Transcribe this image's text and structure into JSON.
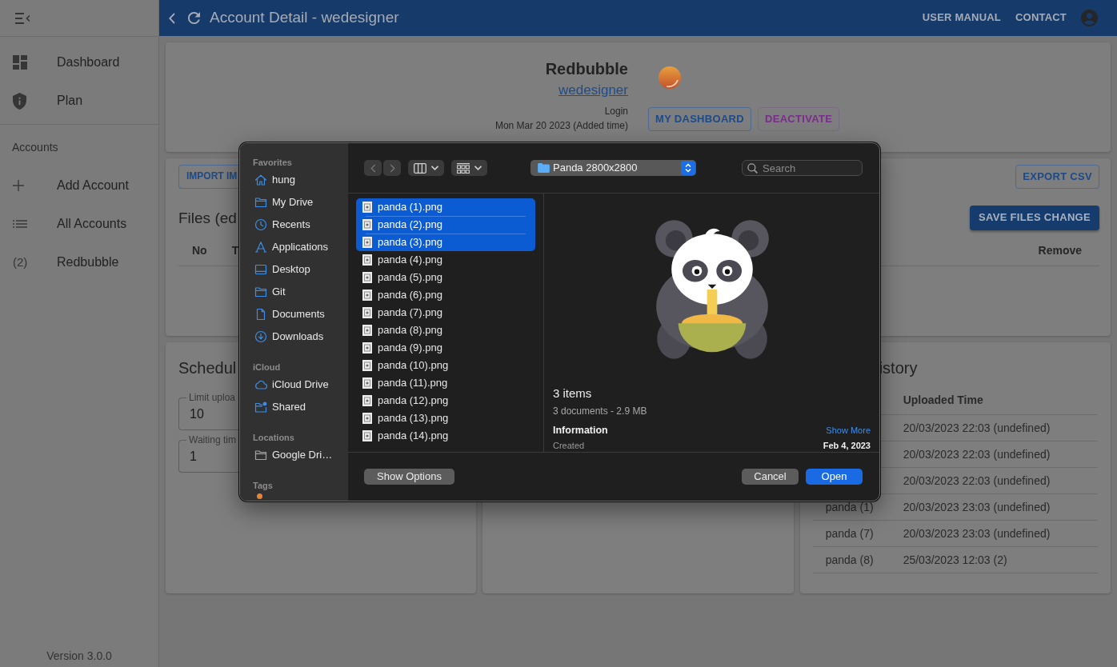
{
  "sidebar": {
    "nav": [
      {
        "label": "Dashboard"
      },
      {
        "label": "Plan"
      }
    ],
    "section_title": "Accounts",
    "accounts": [
      {
        "label": "Add Account"
      },
      {
        "label": "All Accounts"
      },
      {
        "label": "Redbubble",
        "count": "(2)"
      }
    ],
    "version": "Version 3.0.0"
  },
  "header": {
    "title": "Account Detail - wedesigner",
    "links": [
      "USER MANUAL",
      "CONTACT"
    ]
  },
  "account": {
    "platform": "Redbubble",
    "username": "wedesigner",
    "status": "Login",
    "added": "Mon Mar 20 2023 (Added time)",
    "buttons": [
      {
        "label": "MY DASHBOARD",
        "kind": "primary"
      },
      {
        "label": "DEACTIVATE",
        "kind": "secondary"
      }
    ]
  },
  "files": {
    "import_button": "IMPORT IM",
    "export_button": "EXPORT CSV",
    "title": "Files (ed",
    "save_button": "SAVE FILES CHANGE",
    "columns": [
      "No",
      "T",
      "Remove"
    ]
  },
  "schedule": {
    "title": "Schedul",
    "fields": [
      {
        "label": "Limit uploa",
        "value": "10"
      },
      {
        "label": "Waiting tim",
        "value": "1"
      }
    ]
  },
  "history": {
    "title": "istory",
    "time_header": "Uploaded Time",
    "rows": [
      {
        "time": "20/03/2023 22:03 (undefined)"
      },
      {
        "time": "20/03/2023 22:03 (undefined)"
      },
      {
        "time": "20/03/2023 22:03 (undefined)"
      },
      {
        "name": "panda (1)",
        "time": "20/03/2023 23:03 (undefined)"
      },
      {
        "name": "panda (7)",
        "time": "20/03/2023 23:03 (undefined)"
      },
      {
        "name": "panda (8)",
        "time": "25/03/2023 12:03 (2)"
      }
    ]
  },
  "file_dialog": {
    "sidebar": [
      {
        "heading": "Favorites",
        "items": [
          {
            "label": "hung"
          },
          {
            "label": "My Drive"
          },
          {
            "label": "Recents"
          },
          {
            "label": "Applications"
          },
          {
            "label": "Desktop"
          },
          {
            "label": "Git"
          },
          {
            "label": "Documents"
          },
          {
            "label": "Downloads"
          }
        ]
      },
      {
        "heading": "iCloud",
        "items": [
          {
            "label": "iCloud Drive"
          },
          {
            "label": "Shared"
          }
        ]
      },
      {
        "heading": "Locations",
        "items": [
          {
            "label": "Google Dri…"
          }
        ]
      },
      {
        "heading": "Tags",
        "items": [
          {
            "color": "#e8843a"
          }
        ]
      }
    ],
    "toolbar": {
      "back_disabled": true,
      "forward_disabled": true,
      "location": "Panda 2800x2800",
      "search_placeholder": "Search"
    },
    "files": [
      {
        "name": "panda (1).png",
        "selected": true
      },
      {
        "name": "panda (2).png",
        "selected": true
      },
      {
        "name": "panda (3).png",
        "selected": true
      },
      {
        "name": "panda (4).png",
        "selected": false
      },
      {
        "name": "panda (5).png",
        "selected": false
      },
      {
        "name": "panda (6).png",
        "selected": false
      },
      {
        "name": "panda (7).png",
        "selected": false
      },
      {
        "name": "panda (8).png",
        "selected": false
      },
      {
        "name": "panda (9).png",
        "selected": false
      },
      {
        "name": "panda (10).png",
        "selected": false
      },
      {
        "name": "panda (11).png",
        "selected": false
      },
      {
        "name": "panda (12).png",
        "selected": false
      },
      {
        "name": "panda (13).png",
        "selected": false
      },
      {
        "name": "panda (14).png",
        "selected": false
      }
    ],
    "preview": {
      "title": "3 items",
      "summary": "3 documents - 2.9 MB",
      "info_heading": "Information",
      "show_more": "Show More",
      "fields": [
        {
          "label": "Created",
          "value": "Feb 4, 2023"
        }
      ]
    },
    "options_button": "Show Options",
    "cancel_button": "Cancel",
    "open_button": "Open"
  }
}
